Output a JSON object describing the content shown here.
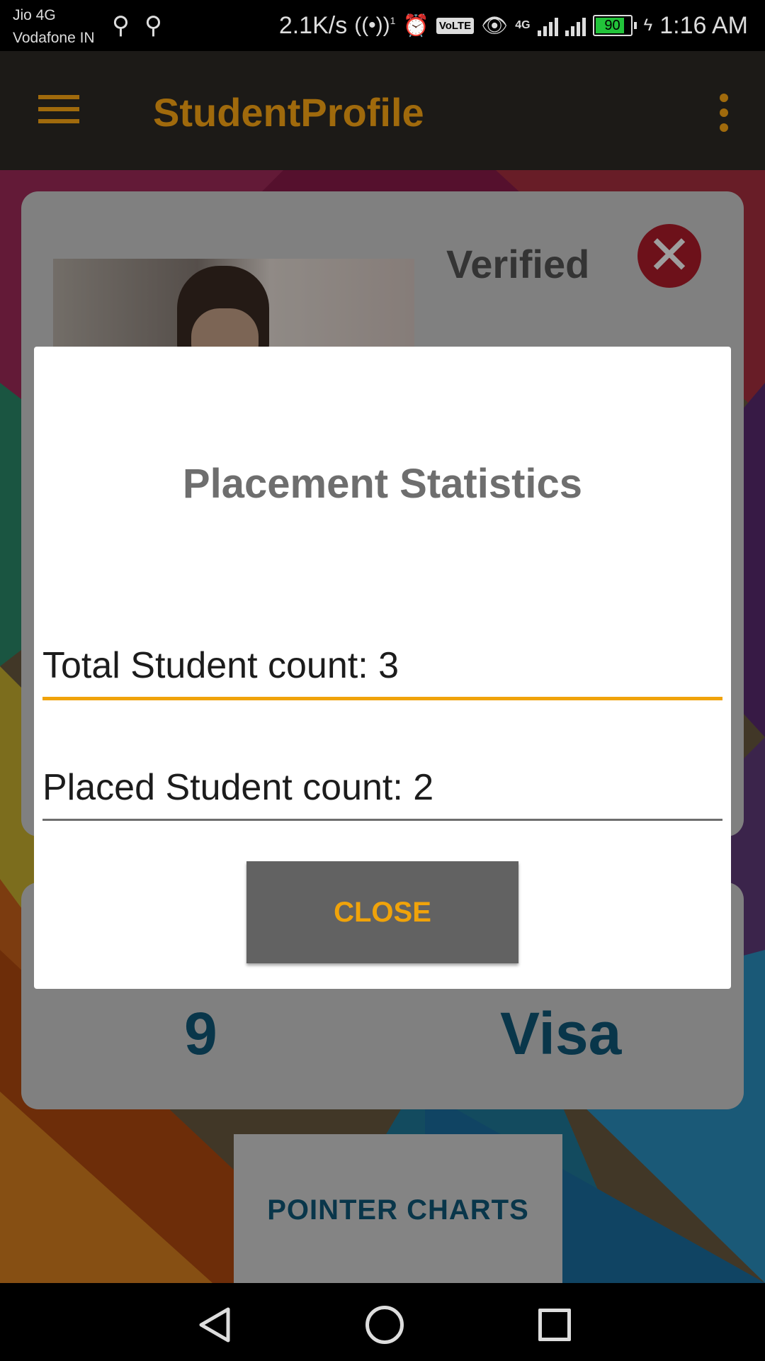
{
  "status_bar": {
    "carrier_line1": "Jio 4G",
    "carrier_line2": "Vodafone IN",
    "net_speed": "2.1K/s",
    "hotspot_sup": "1",
    "volte": "VoLTE",
    "network_type": "4G",
    "battery_level": "90",
    "battery_fraction": 0.9,
    "time": "1:16 AM"
  },
  "app_bar": {
    "title": "StudentProfile"
  },
  "profile_card": {
    "status_label": "Verified",
    "close_glyph": "✕"
  },
  "stats_card": {
    "value_left": "9",
    "value_right": "Visa"
  },
  "pointer_charts_button": {
    "label": "POINTER CHARTS"
  },
  "dialog": {
    "title": "Placement Statistics",
    "total_field": "Total Student count: 3",
    "placed_field": "Placed Student count: 2",
    "close_label": "CLOSE"
  },
  "colors": {
    "accent_orange": "#f0a30a",
    "title_brown": "#a06a0c",
    "badge_red": "#b01c2b",
    "stat_blue": "#0f5878"
  }
}
